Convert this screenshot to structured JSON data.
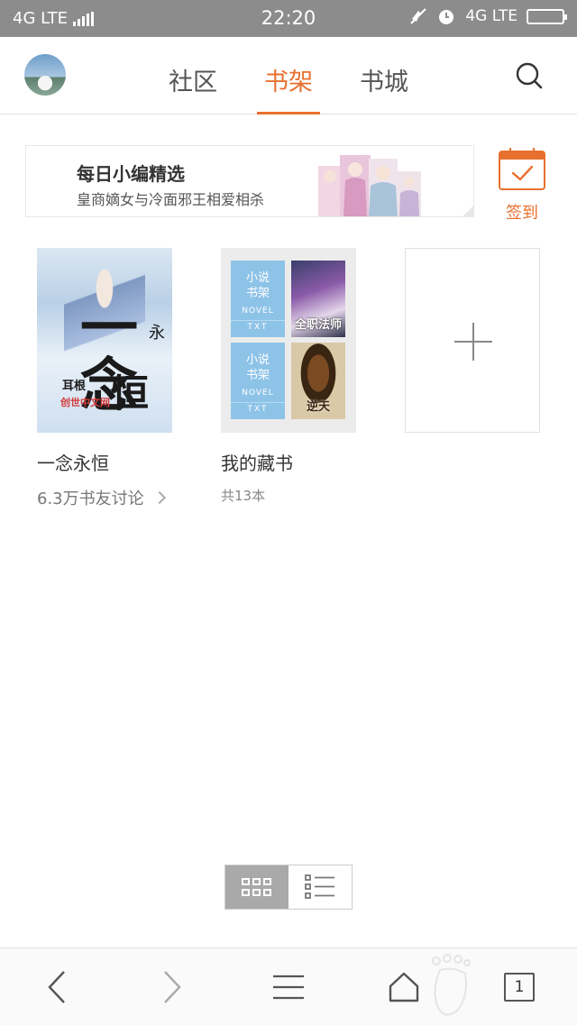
{
  "status_bar": {
    "network_left": "4G LTE",
    "time": "22:20",
    "network_right": "4G LTE"
  },
  "header": {
    "tabs": [
      {
        "label": "社区",
        "active": false
      },
      {
        "label": "书架",
        "active": true
      },
      {
        "label": "书城",
        "active": false
      }
    ],
    "accent_color": "#e8702f"
  },
  "banner": {
    "title": "每日小编精选",
    "subtitle": "皇商嫡女与冷面邪王相爱相杀"
  },
  "checkin": {
    "label": "签到"
  },
  "shelf": {
    "book": {
      "title": "一念永恒",
      "meta": "6.3万书友讨论",
      "cover": {
        "calligraphy_main": "一念",
        "calligraphy_sub": "恒",
        "calligraphy_side": "永",
        "author": "耳根",
        "publisher": "创世中文网"
      }
    },
    "folder": {
      "title": "我的藏书",
      "meta": "共13本",
      "thumbs": [
        {
          "line1": "小说",
          "line2": "书架",
          "en": "NOVEL",
          "ext": "TXT"
        },
        {
          "title": "全职法师"
        },
        {
          "line1": "小说",
          "line2": "书架",
          "en": "NOVEL",
          "ext": "TXT"
        },
        {
          "title": "逆天"
        }
      ]
    }
  },
  "view_toggle": {
    "active": "grid"
  },
  "bottom_nav": {
    "tab_count": "1"
  },
  "icons": [
    "search-icon",
    "calendar-check-icon",
    "plus-icon",
    "grid-view-icon",
    "list-view-icon",
    "back-icon",
    "forward-icon",
    "menu-icon",
    "home-icon",
    "tabs-icon"
  ]
}
